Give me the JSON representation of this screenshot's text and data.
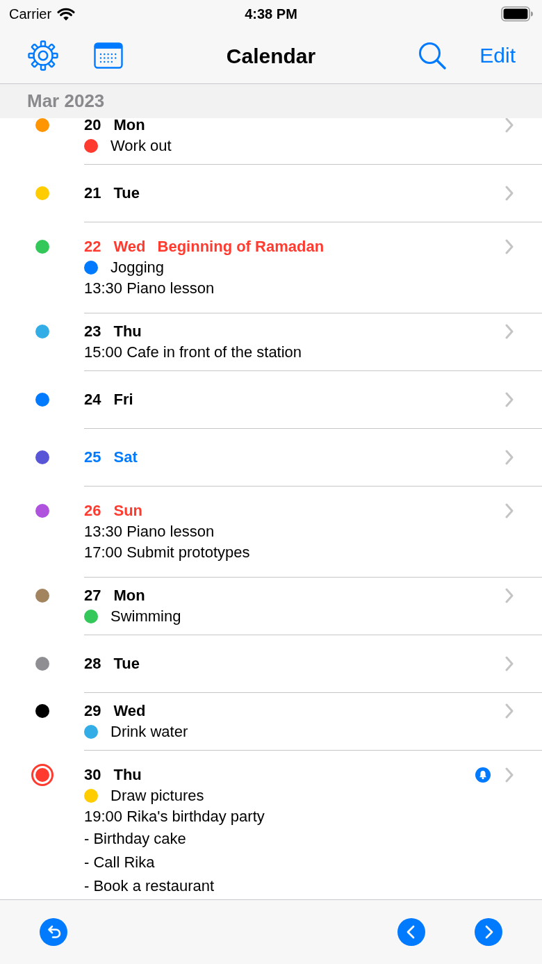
{
  "status_bar": {
    "carrier": "Carrier",
    "time": "4:38 PM"
  },
  "nav_bar": {
    "title": "Calendar",
    "edit_button": "Edit"
  },
  "section": {
    "title": "Mar 2023"
  },
  "days": [
    {
      "day": "20",
      "weekday": "Mon",
      "kind": "weekday",
      "color": "#ff9500",
      "today": false,
      "alarm": false,
      "events": [
        {
          "kind": "all_day",
          "color": "#ff3b30",
          "text": "Work out"
        }
      ]
    },
    {
      "day": "21",
      "weekday": "Tue",
      "kind": "weekday",
      "color": "#ffcc00",
      "today": false,
      "alarm": false
    },
    {
      "day": "22",
      "weekday": "Wed",
      "kind": "holiday",
      "holiday": "Beginning of Ramadan",
      "color": "#34c759",
      "today": false,
      "alarm": false,
      "events": [
        {
          "kind": "all_day",
          "color": "#007aff",
          "text": "Jogging"
        },
        {
          "kind": "timed",
          "text": "13:30 Piano lesson"
        }
      ]
    },
    {
      "day": "23",
      "weekday": "Thu",
      "kind": "weekday",
      "color": "#32ade6",
      "today": false,
      "alarm": false,
      "events": [
        {
          "kind": "timed",
          "text": "15:00 Cafe in front of the station"
        }
      ]
    },
    {
      "day": "24",
      "weekday": "Fri",
      "kind": "weekday",
      "color": "#007aff",
      "today": false,
      "alarm": false
    },
    {
      "day": "25",
      "weekday": "Sat",
      "kind": "saturday",
      "color": "#5856d6",
      "today": false,
      "alarm": false
    },
    {
      "day": "26",
      "weekday": "Sun",
      "kind": "sunday",
      "color": "#af52de",
      "today": false,
      "alarm": false,
      "events": [
        {
          "kind": "timed",
          "text": "13:30 Piano lesson"
        },
        {
          "kind": "timed",
          "text": "17:00 Submit prototypes"
        }
      ]
    },
    {
      "day": "27",
      "weekday": "Mon",
      "kind": "weekday",
      "color": "#a2845e",
      "today": false,
      "alarm": false,
      "events": [
        {
          "kind": "all_day",
          "color": "#34c759",
          "text": "Swimming"
        }
      ]
    },
    {
      "day": "28",
      "weekday": "Tue",
      "kind": "weekday",
      "color": "#8e8e93",
      "today": false,
      "alarm": false
    },
    {
      "day": "29",
      "weekday": "Wed",
      "kind": "weekday",
      "color": "#000000",
      "today": false,
      "alarm": false,
      "events": [
        {
          "kind": "all_day",
          "color": "#32ade6",
          "text": "Drink water"
        }
      ]
    },
    {
      "day": "30",
      "weekday": "Thu",
      "kind": "weekday",
      "color": "#ff3b30",
      "today": true,
      "alarm": true,
      "events": [
        {
          "kind": "all_day",
          "color": "#ffcc00",
          "text": "Draw pictures"
        },
        {
          "kind": "timed",
          "text": "19:00 Rika's birthday party"
        },
        {
          "kind": "note",
          "text": "- Birthday cake"
        },
        {
          "kind": "note",
          "text": "- Call Rika"
        },
        {
          "kind": "note",
          "text": "- Book a restaurant"
        }
      ]
    }
  ]
}
